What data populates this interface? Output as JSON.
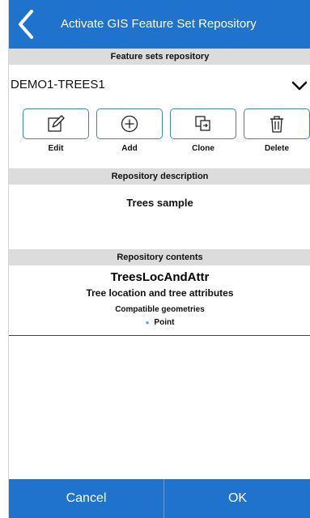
{
  "header": {
    "title": "Activate GIS Feature Set Repository",
    "back_icon": "chevron-left-icon"
  },
  "repository": {
    "section_title": "Feature sets repository",
    "selected": "DEMO1-TREES1"
  },
  "toolbar": {
    "edit_label": "Edit",
    "add_label": "Add",
    "clone_label": "Clone",
    "delete_label": "Delete"
  },
  "description": {
    "section_title": "Repository description",
    "text": "Trees sample"
  },
  "contents": {
    "section_title": "Repository contents",
    "name": "TreesLocAndAttr",
    "description": "Tree location and tree attributes",
    "compat_title": "Compatible geometries",
    "geometries": [
      "Point"
    ]
  },
  "footer": {
    "cancel_label": "Cancel",
    "ok_label": "OK"
  },
  "colors": {
    "accent": "#1f73cc",
    "section_bg": "#dcdcdc",
    "button_border": "#3b82c8"
  }
}
